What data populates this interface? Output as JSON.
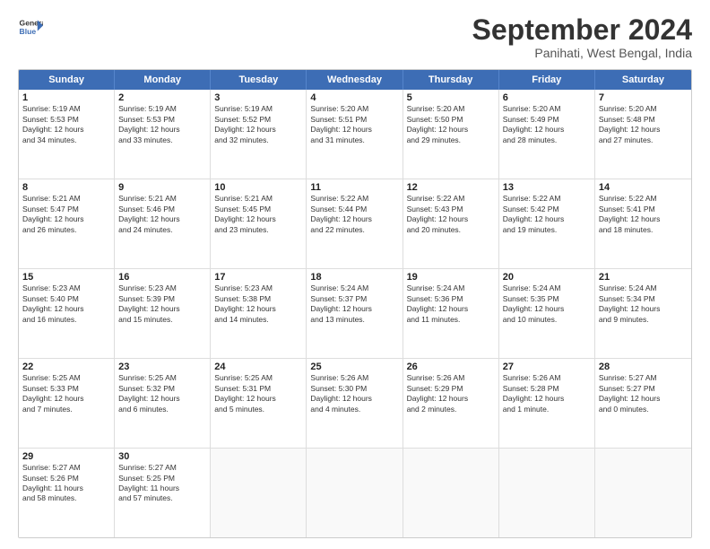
{
  "header": {
    "logo_line1": "General",
    "logo_line2": "Blue",
    "month": "September 2024",
    "location": "Panihati, West Bengal, India"
  },
  "weekdays": [
    "Sunday",
    "Monday",
    "Tuesday",
    "Wednesday",
    "Thursday",
    "Friday",
    "Saturday"
  ],
  "rows": [
    [
      {
        "day": "1",
        "lines": [
          "Sunrise: 5:19 AM",
          "Sunset: 5:53 PM",
          "Daylight: 12 hours",
          "and 34 minutes."
        ]
      },
      {
        "day": "2",
        "lines": [
          "Sunrise: 5:19 AM",
          "Sunset: 5:53 PM",
          "Daylight: 12 hours",
          "and 33 minutes."
        ]
      },
      {
        "day": "3",
        "lines": [
          "Sunrise: 5:19 AM",
          "Sunset: 5:52 PM",
          "Daylight: 12 hours",
          "and 32 minutes."
        ]
      },
      {
        "day": "4",
        "lines": [
          "Sunrise: 5:20 AM",
          "Sunset: 5:51 PM",
          "Daylight: 12 hours",
          "and 31 minutes."
        ]
      },
      {
        "day": "5",
        "lines": [
          "Sunrise: 5:20 AM",
          "Sunset: 5:50 PM",
          "Daylight: 12 hours",
          "and 29 minutes."
        ]
      },
      {
        "day": "6",
        "lines": [
          "Sunrise: 5:20 AM",
          "Sunset: 5:49 PM",
          "Daylight: 12 hours",
          "and 28 minutes."
        ]
      },
      {
        "day": "7",
        "lines": [
          "Sunrise: 5:20 AM",
          "Sunset: 5:48 PM",
          "Daylight: 12 hours",
          "and 27 minutes."
        ]
      }
    ],
    [
      {
        "day": "8",
        "lines": [
          "Sunrise: 5:21 AM",
          "Sunset: 5:47 PM",
          "Daylight: 12 hours",
          "and 26 minutes."
        ]
      },
      {
        "day": "9",
        "lines": [
          "Sunrise: 5:21 AM",
          "Sunset: 5:46 PM",
          "Daylight: 12 hours",
          "and 24 minutes."
        ]
      },
      {
        "day": "10",
        "lines": [
          "Sunrise: 5:21 AM",
          "Sunset: 5:45 PM",
          "Daylight: 12 hours",
          "and 23 minutes."
        ]
      },
      {
        "day": "11",
        "lines": [
          "Sunrise: 5:22 AM",
          "Sunset: 5:44 PM",
          "Daylight: 12 hours",
          "and 22 minutes."
        ]
      },
      {
        "day": "12",
        "lines": [
          "Sunrise: 5:22 AM",
          "Sunset: 5:43 PM",
          "Daylight: 12 hours",
          "and 20 minutes."
        ]
      },
      {
        "day": "13",
        "lines": [
          "Sunrise: 5:22 AM",
          "Sunset: 5:42 PM",
          "Daylight: 12 hours",
          "and 19 minutes."
        ]
      },
      {
        "day": "14",
        "lines": [
          "Sunrise: 5:22 AM",
          "Sunset: 5:41 PM",
          "Daylight: 12 hours",
          "and 18 minutes."
        ]
      }
    ],
    [
      {
        "day": "15",
        "lines": [
          "Sunrise: 5:23 AM",
          "Sunset: 5:40 PM",
          "Daylight: 12 hours",
          "and 16 minutes."
        ]
      },
      {
        "day": "16",
        "lines": [
          "Sunrise: 5:23 AM",
          "Sunset: 5:39 PM",
          "Daylight: 12 hours",
          "and 15 minutes."
        ]
      },
      {
        "day": "17",
        "lines": [
          "Sunrise: 5:23 AM",
          "Sunset: 5:38 PM",
          "Daylight: 12 hours",
          "and 14 minutes."
        ]
      },
      {
        "day": "18",
        "lines": [
          "Sunrise: 5:24 AM",
          "Sunset: 5:37 PM",
          "Daylight: 12 hours",
          "and 13 minutes."
        ]
      },
      {
        "day": "19",
        "lines": [
          "Sunrise: 5:24 AM",
          "Sunset: 5:36 PM",
          "Daylight: 12 hours",
          "and 11 minutes."
        ]
      },
      {
        "day": "20",
        "lines": [
          "Sunrise: 5:24 AM",
          "Sunset: 5:35 PM",
          "Daylight: 12 hours",
          "and 10 minutes."
        ]
      },
      {
        "day": "21",
        "lines": [
          "Sunrise: 5:24 AM",
          "Sunset: 5:34 PM",
          "Daylight: 12 hours",
          "and 9 minutes."
        ]
      }
    ],
    [
      {
        "day": "22",
        "lines": [
          "Sunrise: 5:25 AM",
          "Sunset: 5:33 PM",
          "Daylight: 12 hours",
          "and 7 minutes."
        ]
      },
      {
        "day": "23",
        "lines": [
          "Sunrise: 5:25 AM",
          "Sunset: 5:32 PM",
          "Daylight: 12 hours",
          "and 6 minutes."
        ]
      },
      {
        "day": "24",
        "lines": [
          "Sunrise: 5:25 AM",
          "Sunset: 5:31 PM",
          "Daylight: 12 hours",
          "and 5 minutes."
        ]
      },
      {
        "day": "25",
        "lines": [
          "Sunrise: 5:26 AM",
          "Sunset: 5:30 PM",
          "Daylight: 12 hours",
          "and 4 minutes."
        ]
      },
      {
        "day": "26",
        "lines": [
          "Sunrise: 5:26 AM",
          "Sunset: 5:29 PM",
          "Daylight: 12 hours",
          "and 2 minutes."
        ]
      },
      {
        "day": "27",
        "lines": [
          "Sunrise: 5:26 AM",
          "Sunset: 5:28 PM",
          "Daylight: 12 hours",
          "and 1 minute."
        ]
      },
      {
        "day": "28",
        "lines": [
          "Sunrise: 5:27 AM",
          "Sunset: 5:27 PM",
          "Daylight: 12 hours",
          "and 0 minutes."
        ]
      }
    ],
    [
      {
        "day": "29",
        "lines": [
          "Sunrise: 5:27 AM",
          "Sunset: 5:26 PM",
          "Daylight: 11 hours",
          "and 58 minutes."
        ]
      },
      {
        "day": "30",
        "lines": [
          "Sunrise: 5:27 AM",
          "Sunset: 5:25 PM",
          "Daylight: 11 hours",
          "and 57 minutes."
        ]
      },
      {
        "day": "",
        "lines": []
      },
      {
        "day": "",
        "lines": []
      },
      {
        "day": "",
        "lines": []
      },
      {
        "day": "",
        "lines": []
      },
      {
        "day": "",
        "lines": []
      }
    ]
  ]
}
